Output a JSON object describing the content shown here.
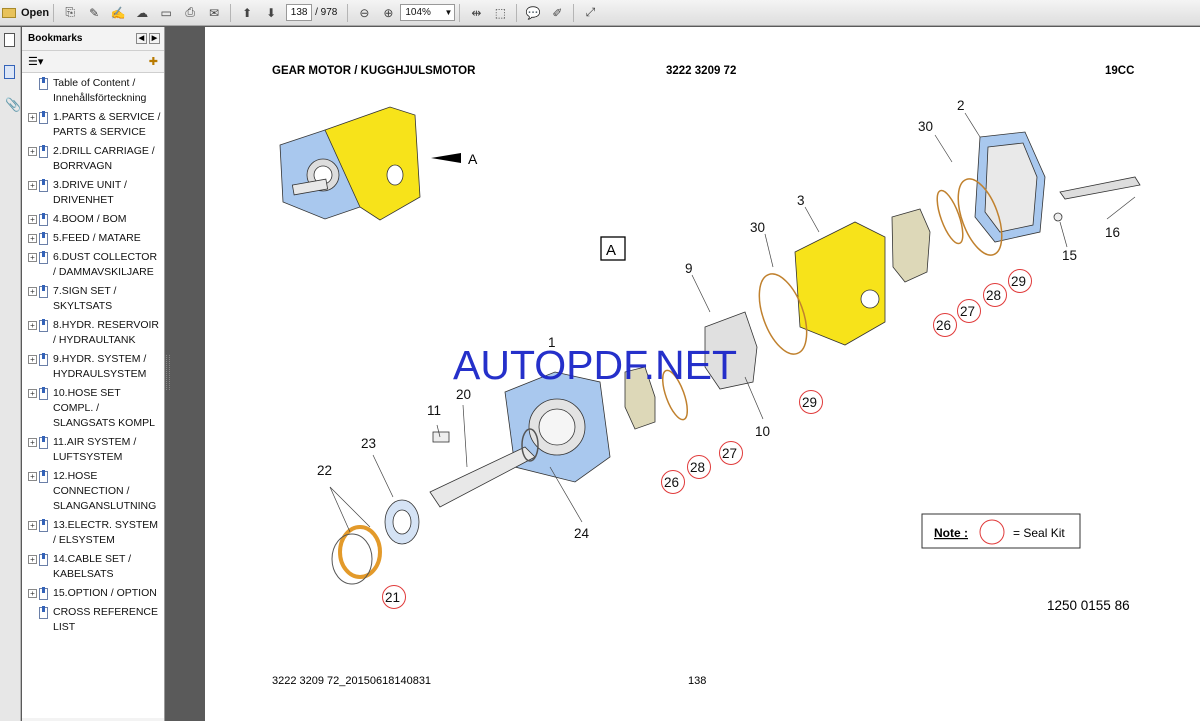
{
  "toolbar": {
    "open_label": "Open",
    "current_page": "138",
    "total_pages": "/ 978",
    "zoom": "104%"
  },
  "bookmarks": {
    "title": "Bookmarks",
    "items": [
      {
        "expandable": false,
        "label": "Table of Content / Innehållsförteckning"
      },
      {
        "expandable": true,
        "label": "1.PARTS & SERVICE / PARTS & SERVICE"
      },
      {
        "expandable": true,
        "label": "2.DRILL CARRIAGE / BORRVAGN"
      },
      {
        "expandable": true,
        "label": "3.DRIVE UNIT / DRIVENHET"
      },
      {
        "expandable": true,
        "label": "4.BOOM / BOM"
      },
      {
        "expandable": true,
        "label": "5.FEED / MATARE"
      },
      {
        "expandable": true,
        "label": "6.DUST COLLECTOR / DAMMAVSKILJARE"
      },
      {
        "expandable": true,
        "label": "7.SIGN SET / SKYLTSATS"
      },
      {
        "expandable": true,
        "label": "8.HYDR. RESERVOIR / HYDRAULTANK"
      },
      {
        "expandable": true,
        "label": "9.HYDR. SYSTEM / HYDRAULSYSTEM"
      },
      {
        "expandable": true,
        "label": "10.HOSE SET COMPL. / SLANGSATS KOMPL"
      },
      {
        "expandable": true,
        "label": "11.AIR SYSTEM / LUFTSYSTEM"
      },
      {
        "expandable": true,
        "label": "12.HOSE CONNECTION / SLANGANSLUTNING"
      },
      {
        "expandable": true,
        "label": "13.ELECTR. SYSTEM / ELSYSTEM"
      },
      {
        "expandable": true,
        "label": "14.CABLE SET / KABELSATS"
      },
      {
        "expandable": true,
        "label": "15.OPTION / OPTION"
      },
      {
        "expandable": false,
        "label": "CROSS REFERENCE LIST"
      }
    ]
  },
  "document": {
    "header_title": "GEAR MOTOR / KUGGHJULSMOTOR",
    "header_part": "3222 3209 72",
    "header_code": "19CC",
    "view_label": "A",
    "arrow_label": "A",
    "watermark": "AUTOPDF.NET",
    "note_label": "Note :",
    "note_text": "= Seal Kit",
    "drawing_number": "1250 0155 86",
    "footer_left": "3222 3209 72_20150618140831",
    "footer_page": "138",
    "callouts": [
      "2",
      "30",
      "3",
      "30",
      "9",
      "16",
      "15",
      "29",
      "28",
      "27",
      "26",
      "29",
      "1",
      "20",
      "11",
      "10",
      "27",
      "28",
      "26",
      "23",
      "22",
      "24",
      "21"
    ],
    "seal_kit_callouts": [
      "29",
      "28",
      "27",
      "26",
      "29",
      "27",
      "28",
      "26",
      "21"
    ]
  },
  "colors": {
    "yellow_part": "#f7e31a",
    "blue_part": "#8cb4e6",
    "seal_circle": "#e03a3a",
    "watermark": "#1a25c8",
    "seal_ring": "#d88a3a"
  }
}
